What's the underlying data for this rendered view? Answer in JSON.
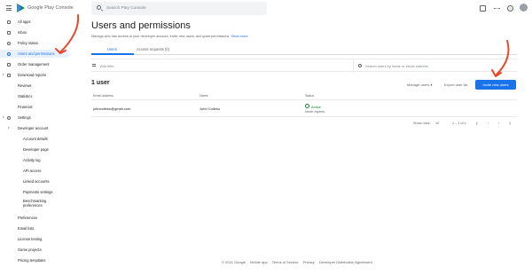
{
  "header": {
    "brand": "Google Play Console",
    "search_placeholder": "Search Play Console",
    "help_glyph": "?"
  },
  "sidebar": {
    "items": [
      {
        "label": "All apps",
        "icon": "apps-icon"
      },
      {
        "label": "Inbox",
        "icon": "inbox-icon"
      },
      {
        "label": "Policy status",
        "icon": "policy-icon"
      },
      {
        "label": "Users and permissions",
        "icon": "users-icon",
        "active": true
      },
      {
        "label": "Order management",
        "icon": "orders-icon"
      },
      {
        "label": "Download reports",
        "icon": "download-icon"
      },
      {
        "label": "Reviews"
      },
      {
        "label": "Statistics"
      },
      {
        "label": "Financial"
      },
      {
        "label": "Settings",
        "icon": "gear-icon"
      },
      {
        "label": "Developer account"
      },
      {
        "label": "Account details"
      },
      {
        "label": "Developer page"
      },
      {
        "label": "Activity log"
      },
      {
        "label": "API access"
      },
      {
        "label": "Linked accounts"
      },
      {
        "label": "Payments settings"
      },
      {
        "label": "Benchmarking preferences"
      },
      {
        "label": "Preferences"
      },
      {
        "label": "Email lists"
      },
      {
        "label": "License testing"
      },
      {
        "label": "Game projects"
      },
      {
        "label": "Pricing templates"
      }
    ]
  },
  "main": {
    "title": "Users and permissions",
    "subtitle": "Manage who has access to your developer account, invite new users, and grant permissions.",
    "show_more": "Show more",
    "tabs": [
      {
        "label": "Users",
        "active": true
      },
      {
        "label": "Access requests (0)"
      }
    ],
    "filter_label": "Add filter",
    "user_search_placeholder": "Search users by name or email address",
    "count_label": "1 user",
    "manage_users": "Manage users",
    "manage_caret": "▾",
    "export_label": "Export user list",
    "invite_label": "Invite new users",
    "table": {
      "columns": [
        "Email address",
        "Name",
        "Status"
      ],
      "rows": [
        {
          "email": "johncolleso@gmail.com",
          "name": "John Colleso",
          "status": "Active",
          "status_detail": "Never expires"
        }
      ]
    },
    "pagination": {
      "rows_label": "Show rows:",
      "rows_value": "10",
      "range": "1 – 1 of 1",
      "first": "|‹",
      "prev": "‹",
      "next": "›",
      "last": "›|"
    }
  },
  "footer": {
    "copyright": "© 2021 Google",
    "links": [
      "Mobile app",
      "Terms of Service",
      "Privacy",
      "Developer Distribution Agreement"
    ]
  },
  "colors": {
    "accent": "#1a73e8",
    "annotation_arrow": "#e8482b",
    "active_status": "#188038"
  }
}
